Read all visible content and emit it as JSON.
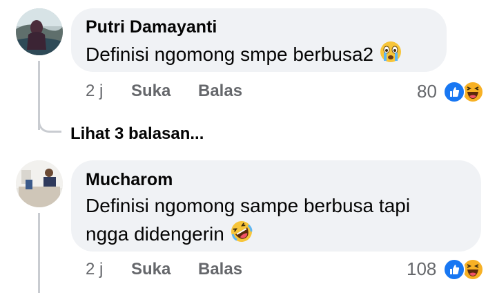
{
  "comments": [
    {
      "author": "Putri Damayanti",
      "text": "Definisi ngomong smpe berbusa2",
      "emoji": "crying-face-emoji",
      "time": "2 j",
      "like_label": "Suka",
      "reply_label": "Balas",
      "reaction_count": "80",
      "reactions": [
        "like-reaction-icon",
        "haha-reaction-icon"
      ]
    },
    {
      "author": "Mucharom",
      "text_line1": "Definisi ngomong sampe berbusa tapi",
      "text_line2": "ngga didengerin",
      "emoji": "rolling-laughing-emoji",
      "time": "2 j",
      "like_label": "Suka",
      "reply_label": "Balas",
      "reaction_count": "108",
      "reactions": [
        "like-reaction-icon",
        "haha-reaction-icon"
      ]
    }
  ],
  "view_replies_label": "Lihat 3 balasan...",
  "colors": {
    "bubble": "#f0f2f5",
    "meta": "#65676b",
    "like_blue": "#1877f2",
    "haha_yellow": "#f7b125"
  }
}
